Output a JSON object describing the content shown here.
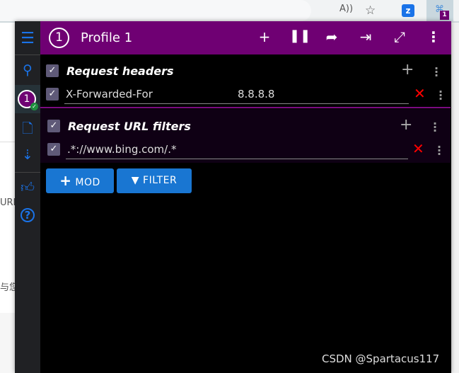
{
  "browser": {
    "read_aloud_icon": "A))",
    "favorite_icon": "☆",
    "extension_badge": "1"
  },
  "background": {
    "text1": "URL",
    "text2": "与您"
  },
  "header": {
    "profile_number": "1",
    "profile_name": "Profile 1"
  },
  "sidebar": {
    "profile_badge": "1"
  },
  "request_headers": {
    "title": "Request headers",
    "items": [
      {
        "name": "X-Forwarded-For",
        "value": "8.8.8.8",
        "enabled": true
      }
    ],
    "enabled": true
  },
  "url_filters": {
    "title": "Request URL filters",
    "items": [
      {
        "value": ".*://www.bing.com/.*",
        "enabled": true
      }
    ],
    "enabled": true
  },
  "buttons": {
    "mod": "MOD",
    "filter": "FILTER"
  },
  "watermark": "CSDN @Spartacus117",
  "colors": {
    "accent": "#6f0073",
    "button": "#1976d2",
    "delete": "#ff0000"
  }
}
